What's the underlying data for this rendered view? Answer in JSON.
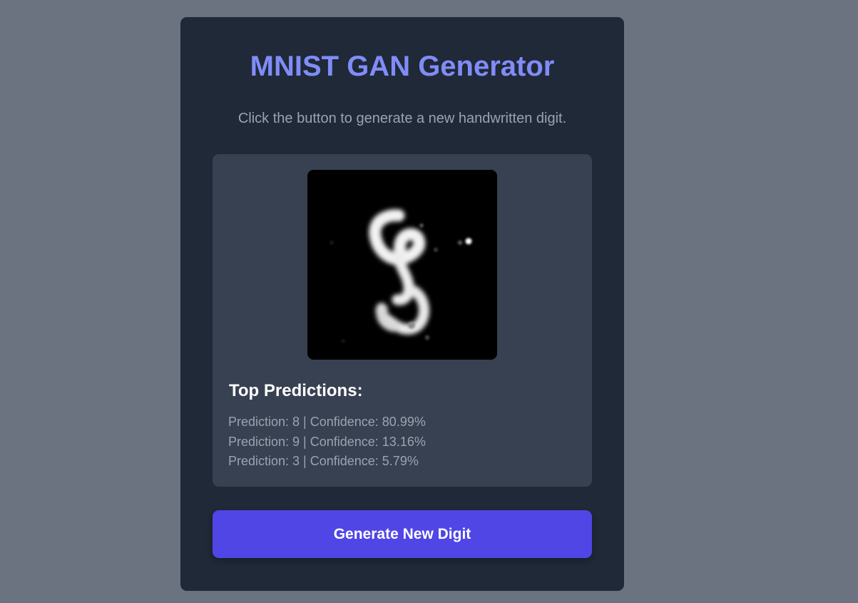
{
  "app": {
    "title": "MNIST GAN Generator",
    "subtitle": "Click the button to generate a new handwritten digit."
  },
  "result": {
    "image_alt": "generated handwritten digit",
    "heading": "Top Predictions:",
    "predictions": [
      "Prediction: 8 | Confidence: 80.99%",
      "Prediction: 9 | Confidence: 13.16%",
      "Prediction: 3 | Confidence: 5.79%"
    ]
  },
  "actions": {
    "generate_label": "Generate New Digit"
  },
  "colors": {
    "page_background": "#6b7280",
    "card_background": "#1f2937",
    "panel_background": "#374151",
    "title_accent": "#818cf8",
    "button_background": "#4f46e5"
  }
}
